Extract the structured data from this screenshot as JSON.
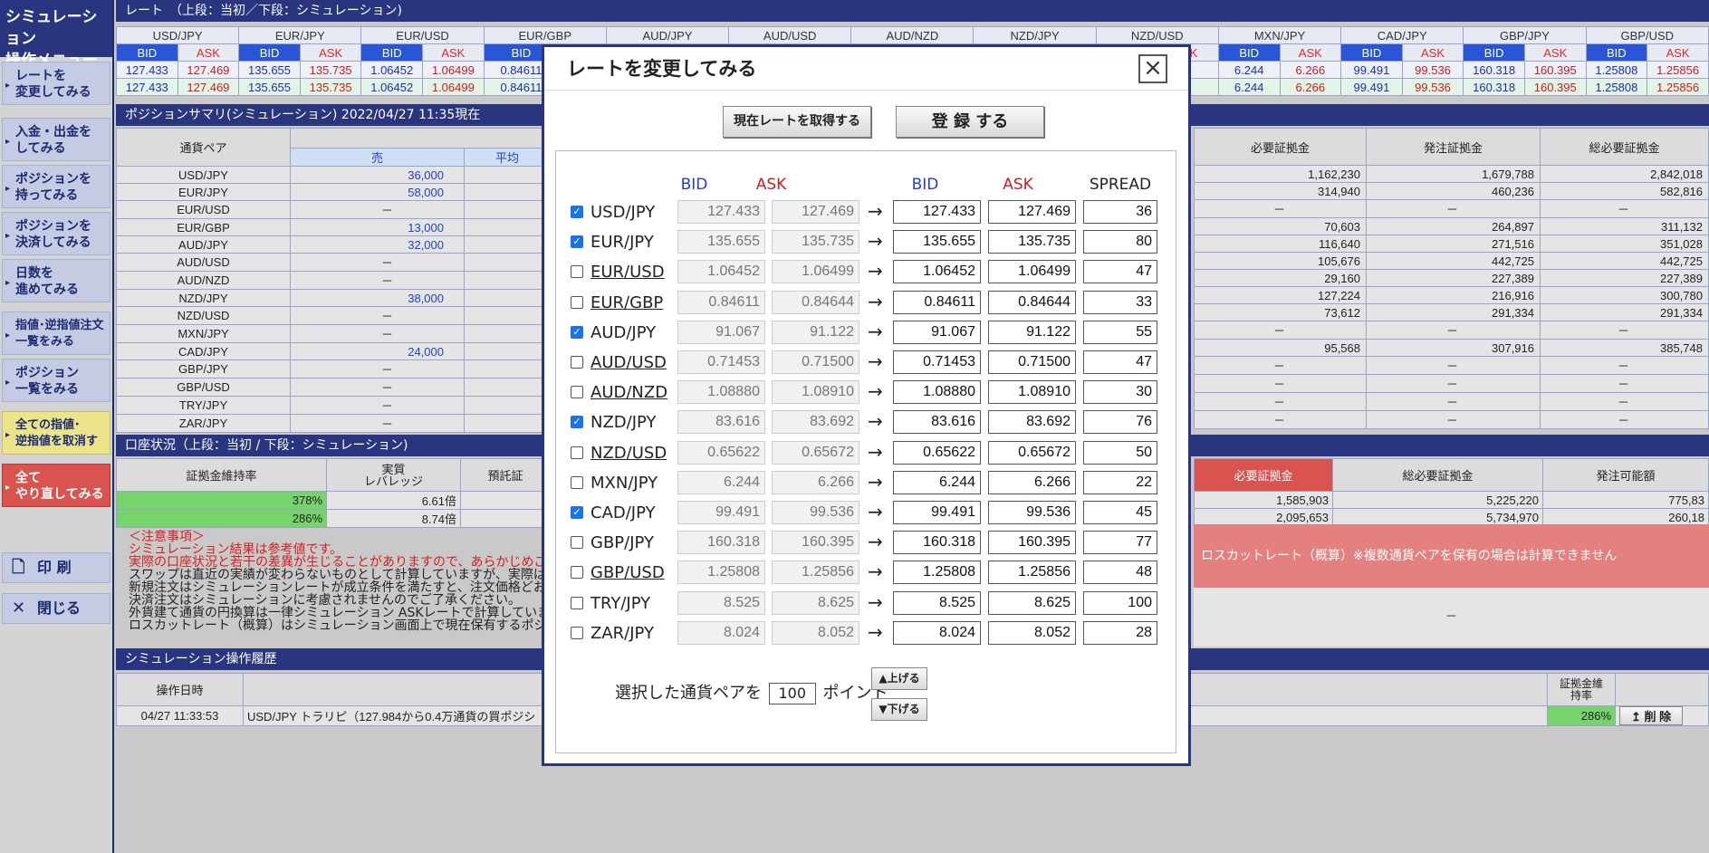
{
  "sidebar": {
    "title1": "シミュレーション",
    "title2": "操作メニュー",
    "items": [
      [
        "レートを",
        "変更してみる"
      ],
      [
        "入金・出金を",
        "してみる"
      ],
      [
        "ポジションを",
        "持ってみる"
      ],
      [
        "ポジションを",
        "決済してみる"
      ],
      [
        "日数を",
        "進めてみる"
      ],
      [
        "指値･逆指値注文",
        "一覧をみる"
      ],
      [
        "ポジション",
        "一覧をみる"
      ],
      [
        "全ての指値･",
        "逆指値を取消す"
      ],
      [
        "全て",
        "やり直してみる"
      ]
    ],
    "print": "印 刷",
    "close": "閉じる"
  },
  "rates": {
    "section": "レート　（上段：当初／下段：シミュレーション)",
    "pairs": [
      "USD/JPY",
      "EUR/JPY",
      "EUR/USD",
      "EUR/GBP",
      "AUD/JPY",
      "AUD/USD",
      "AUD/NZD",
      "NZD/JPY",
      "NZD/USD",
      "MXN/JPY",
      "CAD/JPY",
      "GBP/JPY",
      "GBP/USD"
    ],
    "bid": "BID",
    "ask": "ASK",
    "left_vals": [
      [
        "127.433",
        "127.469"
      ],
      [
        "135.655",
        "135.735"
      ],
      [
        "1.06452",
        "1.06499"
      ],
      [
        "0.84611",
        ""
      ]
    ],
    "right_vals": [
      [
        "6.244",
        "6.266"
      ],
      [
        "99.491",
        "99.536"
      ],
      [
        "160.318",
        "160.395"
      ],
      [
        "1.25808",
        "1.25856"
      ]
    ],
    "frag": "72"
  },
  "positions": {
    "section": "ポジションサマリ(シミュレーション) 2022/04/27 11:35現在",
    "col_pair": "通貨ペア",
    "col_sell": "売",
    "col_avg": "平均",
    "rows": [
      [
        "USD/JPY",
        "36,000"
      ],
      [
        "EUR/JPY",
        "58,000"
      ],
      [
        "EUR/USD",
        "－"
      ],
      [
        "EUR/GBP",
        "13,000"
      ],
      [
        "AUD/JPY",
        "32,000"
      ],
      [
        "AUD/USD",
        "－"
      ],
      [
        "AUD/NZD",
        "－"
      ],
      [
        "NZD/JPY",
        "38,000"
      ],
      [
        "NZD/USD",
        "－"
      ],
      [
        "MXN/JPY",
        "－"
      ],
      [
        "CAD/JPY",
        "24,000"
      ],
      [
        "GBP/JPY",
        "－"
      ],
      [
        "GBP/USD",
        "－"
      ],
      [
        "TRY/JPY",
        "－"
      ],
      [
        "ZAR/JPY",
        "－"
      ]
    ],
    "right_headers": [
      "必要証拠金",
      "発注証拠金",
      "総必要証拠金"
    ],
    "right_rows": [
      [
        "1,162,230",
        "1,679,788",
        "2,842,018"
      ],
      [
        "314,940",
        "460,236",
        "582,816"
      ],
      [
        "－",
        "－",
        "－"
      ],
      [
        "70,603",
        "264,897",
        "311,132"
      ],
      [
        "116,640",
        "271,516",
        "351,028"
      ],
      [
        "105,676",
        "442,725",
        "442,725"
      ],
      [
        "29,160",
        "227,389",
        "227,389"
      ],
      [
        "127,224",
        "216,916",
        "300,780"
      ],
      [
        "73,612",
        "291,334",
        "291,334"
      ],
      [
        "－",
        "－",
        "－"
      ],
      [
        "95,568",
        "307,916",
        "385,748"
      ],
      [
        "－",
        "－",
        "－"
      ],
      [
        "－",
        "－",
        "－"
      ],
      [
        "－",
        "－",
        "－"
      ],
      [
        "－",
        "－",
        "－"
      ]
    ]
  },
  "account": {
    "section": "口座状況（上段：当初 / 下段：シミュレーション)",
    "h1": "証拠金維持率",
    "h2a": "実質",
    "h2b": "レバレッジ",
    "h3": "預託証",
    "r1": [
      "378%",
      "6.61倍"
    ],
    "r2": [
      "286%",
      "8.74倍"
    ],
    "rh": [
      "必要証拠金",
      "総必要証拠金",
      "発注可能額"
    ],
    "rr1": [
      "1,585,903",
      "5,225,220",
      "775,83"
    ],
    "rr2": [
      "2,095,653",
      "5,734,970",
      "260,18"
    ],
    "losscut": "ロスカットレート（概算）※複数通貨ペアを保有の場合は計算できません",
    "dash": "－"
  },
  "notes": {
    "title": "＜注意事項＞",
    "l1": "シミュレーション結果は参考値です。",
    "l2": "実際の口座状況と若干の差異が生じることがありますので、あらかじめご了",
    "l3": "スワップは直近の実績が変わらないものとして計算していますが、実際は市",
    "l4": "新規注文はシミュレーションレートが成立条件を満たすと、注文価格どおり",
    "l5": "決済注文はシミュレーションに考慮されませんのでご了承ください。",
    "l6": "外貨建て通貨の円換算は一律シミュレーション ASKレートで計算していま",
    "l7": "ロスカットレート（概算）はシミュレーション画面上で現在保有するポジション"
  },
  "history": {
    "section": "シミュレーション操作履歴",
    "h_date": "操作日時",
    "h_rate_a": "証拠金維",
    "h_rate_b": "持率",
    "date": "04/27 11:33:53",
    "desc": "USD/JPY トラリピ（127.984から0.4万通貨の買ポジシ",
    "rate": "286%",
    "del": "削 除"
  },
  "dialog": {
    "title": "レートを変更してみる",
    "get_rate": "現在レートを取得する",
    "register": "登 録 する",
    "h_bid": "BID",
    "h_ask": "ASK",
    "h_spread": "SPREAD",
    "arrow": "→",
    "rows": [
      {
        "pair": "USD/JPY",
        "checked": true,
        "u": false,
        "ob": "127.433",
        "oa": "127.469",
        "nb": "127.433",
        "na": "127.469",
        "sp": "36"
      },
      {
        "pair": "EUR/JPY",
        "checked": true,
        "u": false,
        "ob": "135.655",
        "oa": "135.735",
        "nb": "135.655",
        "na": "135.735",
        "sp": "80"
      },
      {
        "pair": "EUR/USD",
        "checked": false,
        "u": true,
        "ob": "1.06452",
        "oa": "1.06499",
        "nb": "1.06452",
        "na": "1.06499",
        "sp": "47"
      },
      {
        "pair": "EUR/GBP",
        "checked": false,
        "u": true,
        "ob": "0.84611",
        "oa": "0.84644",
        "nb": "0.84611",
        "na": "0.84644",
        "sp": "33"
      },
      {
        "pair": "AUD/JPY",
        "checked": true,
        "u": false,
        "ob": "91.067",
        "oa": "91.122",
        "nb": "91.067",
        "na": "91.122",
        "sp": "55"
      },
      {
        "pair": "AUD/USD",
        "checked": false,
        "u": true,
        "ob": "0.71453",
        "oa": "0.71500",
        "nb": "0.71453",
        "na": "0.71500",
        "sp": "47"
      },
      {
        "pair": "AUD/NZD",
        "checked": false,
        "u": true,
        "ob": "1.08880",
        "oa": "1.08910",
        "nb": "1.08880",
        "na": "1.08910",
        "sp": "30"
      },
      {
        "pair": "NZD/JPY",
        "checked": true,
        "u": false,
        "ob": "83.616",
        "oa": "83.692",
        "nb": "83.616",
        "na": "83.692",
        "sp": "76"
      },
      {
        "pair": "NZD/USD",
        "checked": false,
        "u": true,
        "ob": "0.65622",
        "oa": "0.65672",
        "nb": "0.65622",
        "na": "0.65672",
        "sp": "50"
      },
      {
        "pair": "MXN/JPY",
        "checked": false,
        "u": false,
        "ob": "6.244",
        "oa": "6.266",
        "nb": "6.244",
        "na": "6.266",
        "sp": "22"
      },
      {
        "pair": "CAD/JPY",
        "checked": true,
        "u": false,
        "ob": "99.491",
        "oa": "99.536",
        "nb": "99.491",
        "na": "99.536",
        "sp": "45"
      },
      {
        "pair": "GBP/JPY",
        "checked": false,
        "u": false,
        "ob": "160.318",
        "oa": "160.395",
        "nb": "160.318",
        "na": "160.395",
        "sp": "77"
      },
      {
        "pair": "GBP/USD",
        "checked": false,
        "u": true,
        "ob": "1.25808",
        "oa": "1.25856",
        "nb": "1.25808",
        "na": "1.25856",
        "sp": "48"
      },
      {
        "pair": "TRY/JPY",
        "checked": false,
        "u": false,
        "ob": "8.525",
        "oa": "8.625",
        "nb": "8.525",
        "na": "8.625",
        "sp": "100"
      },
      {
        "pair": "ZAR/JPY",
        "checked": false,
        "u": false,
        "ob": "8.024",
        "oa": "8.052",
        "nb": "8.024",
        "na": "8.052",
        "sp": "28"
      }
    ],
    "foot_a": "選択した通貨ペアを",
    "foot_val": "100",
    "foot_b": "ポイント",
    "up": "▲上げる",
    "down": "▼下げる"
  }
}
